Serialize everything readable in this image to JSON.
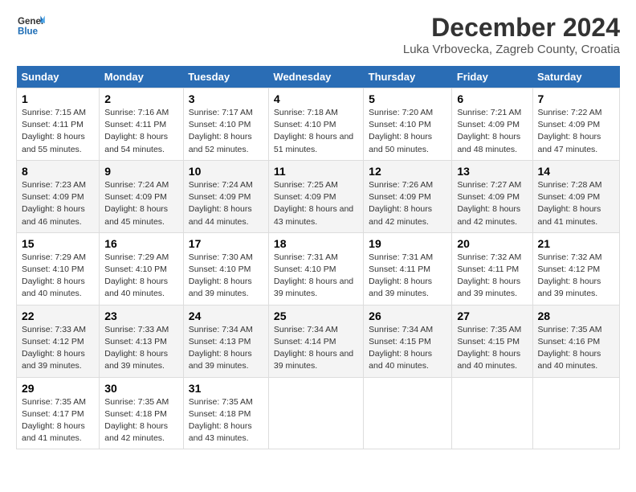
{
  "header": {
    "logo_line1": "General",
    "logo_line2": "Blue",
    "title": "December 2024",
    "subtitle": "Luka Vrbovecka, Zagreb County, Croatia"
  },
  "days_of_week": [
    "Sunday",
    "Monday",
    "Tuesday",
    "Wednesday",
    "Thursday",
    "Friday",
    "Saturday"
  ],
  "weeks": [
    [
      {
        "day": 1,
        "sunrise": "7:15 AM",
        "sunset": "4:11 PM",
        "daylight": "8 hours and 55 minutes."
      },
      {
        "day": 2,
        "sunrise": "7:16 AM",
        "sunset": "4:11 PM",
        "daylight": "8 hours and 54 minutes."
      },
      {
        "day": 3,
        "sunrise": "7:17 AM",
        "sunset": "4:10 PM",
        "daylight": "8 hours and 52 minutes."
      },
      {
        "day": 4,
        "sunrise": "7:18 AM",
        "sunset": "4:10 PM",
        "daylight": "8 hours and 51 minutes."
      },
      {
        "day": 5,
        "sunrise": "7:20 AM",
        "sunset": "4:10 PM",
        "daylight": "8 hours and 50 minutes."
      },
      {
        "day": 6,
        "sunrise": "7:21 AM",
        "sunset": "4:09 PM",
        "daylight": "8 hours and 48 minutes."
      },
      {
        "day": 7,
        "sunrise": "7:22 AM",
        "sunset": "4:09 PM",
        "daylight": "8 hours and 47 minutes."
      }
    ],
    [
      {
        "day": 8,
        "sunrise": "7:23 AM",
        "sunset": "4:09 PM",
        "daylight": "8 hours and 46 minutes."
      },
      {
        "day": 9,
        "sunrise": "7:24 AM",
        "sunset": "4:09 PM",
        "daylight": "8 hours and 45 minutes."
      },
      {
        "day": 10,
        "sunrise": "7:24 AM",
        "sunset": "4:09 PM",
        "daylight": "8 hours and 44 minutes."
      },
      {
        "day": 11,
        "sunrise": "7:25 AM",
        "sunset": "4:09 PM",
        "daylight": "8 hours and 43 minutes."
      },
      {
        "day": 12,
        "sunrise": "7:26 AM",
        "sunset": "4:09 PM",
        "daylight": "8 hours and 42 minutes."
      },
      {
        "day": 13,
        "sunrise": "7:27 AM",
        "sunset": "4:09 PM",
        "daylight": "8 hours and 42 minutes."
      },
      {
        "day": 14,
        "sunrise": "7:28 AM",
        "sunset": "4:09 PM",
        "daylight": "8 hours and 41 minutes."
      }
    ],
    [
      {
        "day": 15,
        "sunrise": "7:29 AM",
        "sunset": "4:10 PM",
        "daylight": "8 hours and 40 minutes."
      },
      {
        "day": 16,
        "sunrise": "7:29 AM",
        "sunset": "4:10 PM",
        "daylight": "8 hours and 40 minutes."
      },
      {
        "day": 17,
        "sunrise": "7:30 AM",
        "sunset": "4:10 PM",
        "daylight": "8 hours and 39 minutes."
      },
      {
        "day": 18,
        "sunrise": "7:31 AM",
        "sunset": "4:10 PM",
        "daylight": "8 hours and 39 minutes."
      },
      {
        "day": 19,
        "sunrise": "7:31 AM",
        "sunset": "4:11 PM",
        "daylight": "8 hours and 39 minutes."
      },
      {
        "day": 20,
        "sunrise": "7:32 AM",
        "sunset": "4:11 PM",
        "daylight": "8 hours and 39 minutes."
      },
      {
        "day": 21,
        "sunrise": "7:32 AM",
        "sunset": "4:12 PM",
        "daylight": "8 hours and 39 minutes."
      }
    ],
    [
      {
        "day": 22,
        "sunrise": "7:33 AM",
        "sunset": "4:12 PM",
        "daylight": "8 hours and 39 minutes."
      },
      {
        "day": 23,
        "sunrise": "7:33 AM",
        "sunset": "4:13 PM",
        "daylight": "8 hours and 39 minutes."
      },
      {
        "day": 24,
        "sunrise": "7:34 AM",
        "sunset": "4:13 PM",
        "daylight": "8 hours and 39 minutes."
      },
      {
        "day": 25,
        "sunrise": "7:34 AM",
        "sunset": "4:14 PM",
        "daylight": "8 hours and 39 minutes."
      },
      {
        "day": 26,
        "sunrise": "7:34 AM",
        "sunset": "4:15 PM",
        "daylight": "8 hours and 40 minutes."
      },
      {
        "day": 27,
        "sunrise": "7:35 AM",
        "sunset": "4:15 PM",
        "daylight": "8 hours and 40 minutes."
      },
      {
        "day": 28,
        "sunrise": "7:35 AM",
        "sunset": "4:16 PM",
        "daylight": "8 hours and 40 minutes."
      }
    ],
    [
      {
        "day": 29,
        "sunrise": "7:35 AM",
        "sunset": "4:17 PM",
        "daylight": "8 hours and 41 minutes."
      },
      {
        "day": 30,
        "sunrise": "7:35 AM",
        "sunset": "4:18 PM",
        "daylight": "8 hours and 42 minutes."
      },
      {
        "day": 31,
        "sunrise": "7:35 AM",
        "sunset": "4:18 PM",
        "daylight": "8 hours and 43 minutes."
      },
      null,
      null,
      null,
      null
    ]
  ]
}
